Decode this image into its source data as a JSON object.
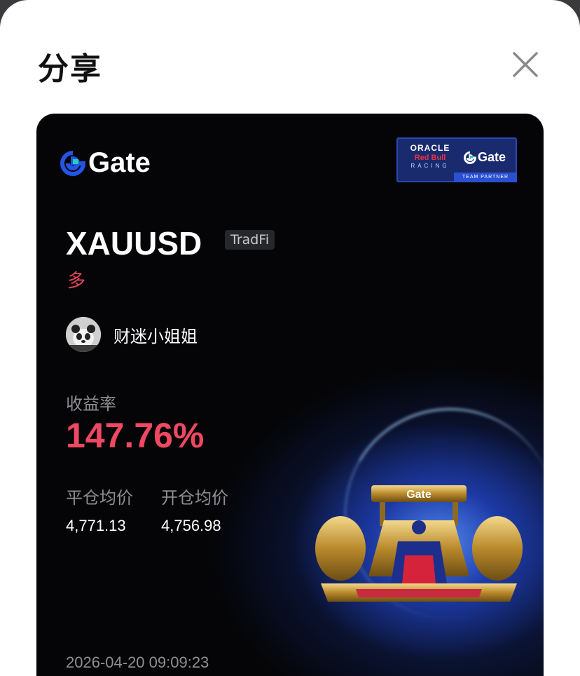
{
  "sheet": {
    "title": "分享"
  },
  "card": {
    "brand": "Gate",
    "partner": {
      "oracle": "ORACLE",
      "redbull": "Red Bull",
      "racing": "RACING",
      "gate": "Gate",
      "strip": "TEAM PARTNER"
    },
    "symbol": "XAUUSD",
    "tag": "TradFi",
    "side": "多",
    "username": "财迷小姐姐",
    "roi_label": "收益率",
    "roi_value": "147.76%",
    "close_price_label": "平仓均价",
    "close_price_value": "4,771.13",
    "open_price_label": "开仓均价",
    "open_price_value": "4,756.98",
    "timestamp": "2026-04-20 09:09:23",
    "car_wing_text": "Gate"
  },
  "colors": {
    "brand_blue": "#2354e6",
    "roi_red": "#ef4862",
    "card_bg": "#050507"
  }
}
